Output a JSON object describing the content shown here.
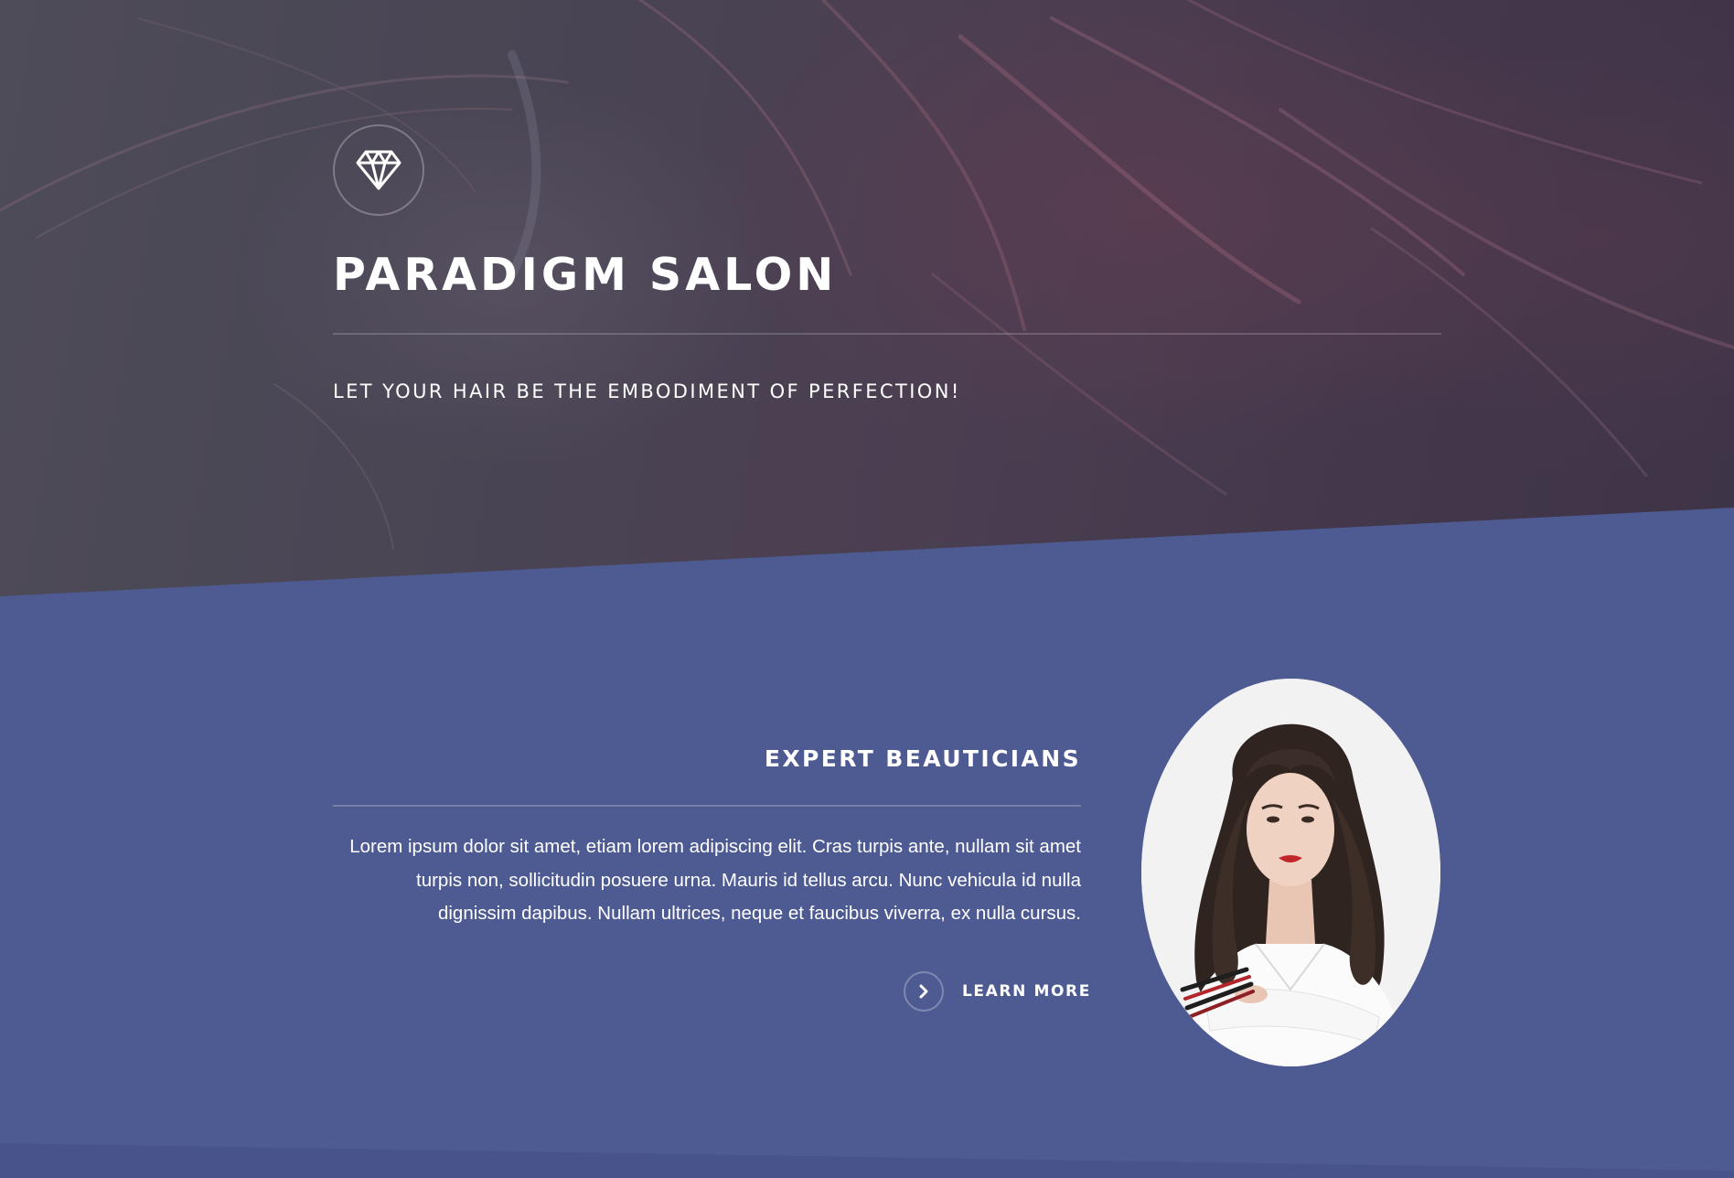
{
  "hero": {
    "title": "PARADIGM SALON",
    "tagline": "LET YOUR HAIR BE THE EMBODIMENT OF PERFECTION!",
    "badge_icon": "diamond-icon"
  },
  "feature": {
    "title": "EXPERT BEAUTICIANS",
    "text": "Lorem ipsum dolor sit amet, etiam lorem adipiscing elit. Cras turpis ante, nullam sit amet turpis non, sollicitudin posuere urna. Mauris id tellus arcu. Nunc vehicula id nulla dignissim dapibus. Nullam ultrices, neque et faucibus viverra, ex nulla cursus.",
    "link_label": "LEARN MORE",
    "link_icon": "chevron-right-icon",
    "image_alt": "beautician-portrait"
  },
  "colors": {
    "section_bg": "#4e5b92",
    "hero_overlay": "#4a4556",
    "text": "#ffffff"
  }
}
